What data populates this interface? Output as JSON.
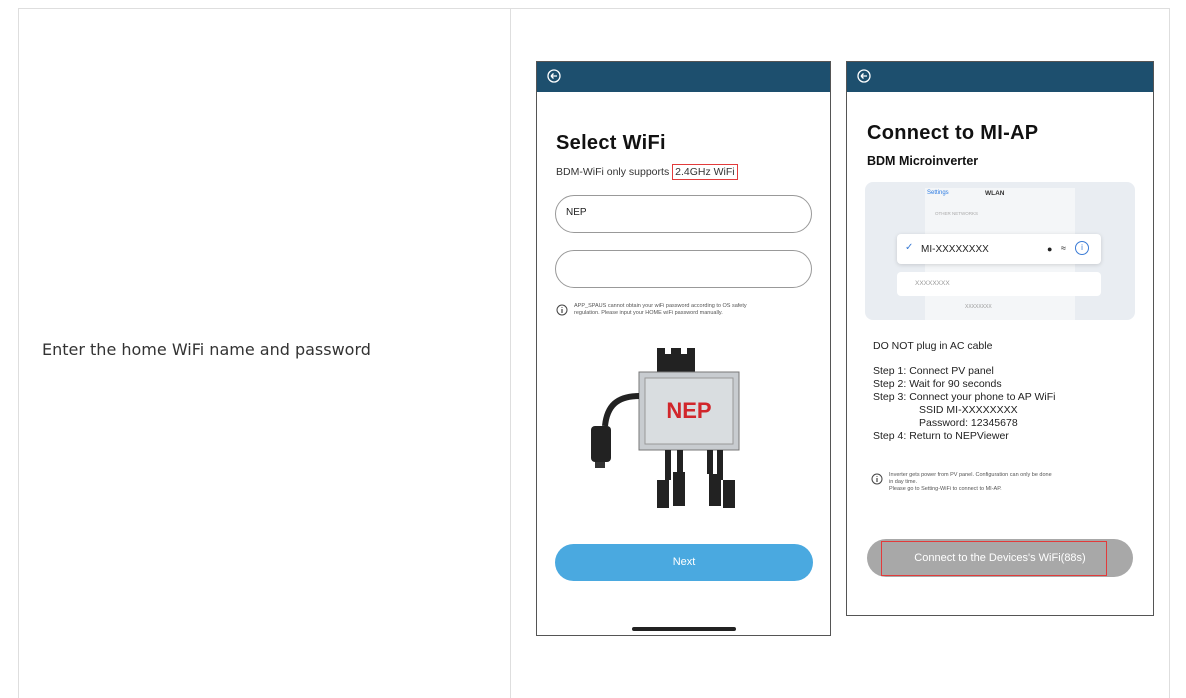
{
  "step_description": "Enter the home WiFi name and password",
  "phone1": {
    "title": "Select WiFi",
    "support_text_prefix": "BDM-WiFi only supports ",
    "support_text_highlight": "2.4GHz WiFi",
    "wifi_name_value": "NEP",
    "password_value": "",
    "info_note_line1": "APP_SPAUS cannot obtain your wiFi password according to OS safety",
    "info_note_line2": "regulation. Please input your HOME wiFi password manually.",
    "product_brand": "NEP",
    "next_button": "Next"
  },
  "phone2": {
    "title": "Connect to MI-AP",
    "subtitle": "BDM Microinverter",
    "settings_back": "Settings",
    "settings_title": "WLAN",
    "settings_section": "OTHER NETWORKS",
    "network_selected": "MI-XXXXXXXX",
    "network_other": "XXXXXXXX",
    "network_other2": "XXXXXXXX",
    "warning": "DO NOT plug in AC cable",
    "step1": "Step 1: Connect PV panel",
    "step2": "Step 2: Wait for 90 seconds",
    "step3": "Step 3: Connect your phone to AP WiFi",
    "ssid": "SSID MI-XXXXXXXX",
    "password": "Password: 12345678",
    "step4": "Step 4: Return to NEPViewer",
    "info_line1": "Inverter gets power from PV panel.  Configuration can only be done",
    "info_line2": "in day time.",
    "info_line3": "Please go to Setting-WiFi to connect to MI-AP.",
    "connect_button": "Connect to the Devices's WiFi(88s)"
  },
  "colors": {
    "topbar": "#1d4f6e",
    "next_button": "#4aa9e0",
    "connect_button": "#a8a8a8",
    "highlight_border": "#e23b3b"
  }
}
